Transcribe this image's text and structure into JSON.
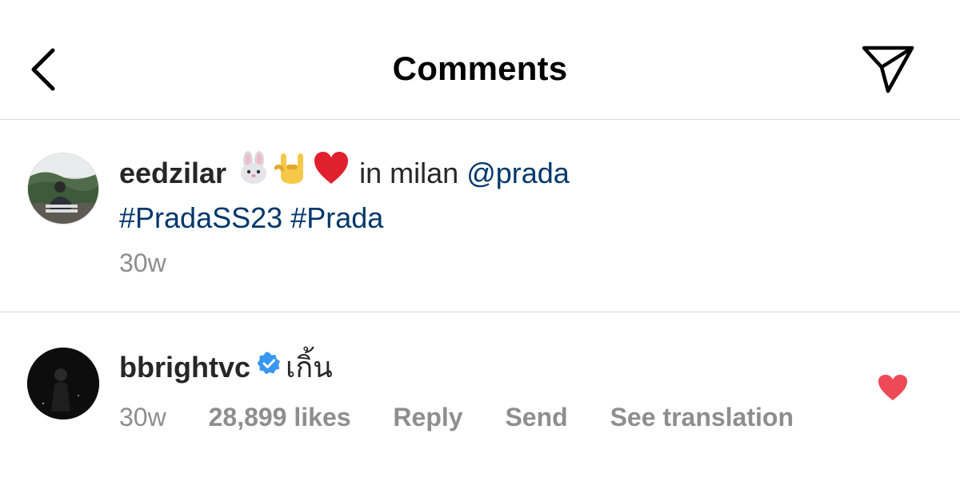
{
  "header": {
    "title": "Comments",
    "back_icon": "chevron-left-icon",
    "share_icon": "paper-plane-icon"
  },
  "caption": {
    "username": "eedzilar",
    "emojis": [
      "rabbit-face-icon",
      "love-you-gesture-icon",
      "red-heart-icon"
    ],
    "text": "in milan",
    "mention": "@prada",
    "hashtags": [
      "#PradaSS23",
      "#Prada"
    ],
    "time": "30w"
  },
  "comment": {
    "username": "bbrightvc",
    "verified": true,
    "text": "เกิ้น",
    "time": "30w",
    "likes": "28,899 likes",
    "reply_label": "Reply",
    "send_label": "Send",
    "translate_label": "See translation",
    "liked": true
  },
  "colors": {
    "link": "#00376b",
    "verified": "#3897f0",
    "like_heart": "#ed4956",
    "meta_text": "#8e8e8e",
    "divider": "#dbdbdb"
  }
}
